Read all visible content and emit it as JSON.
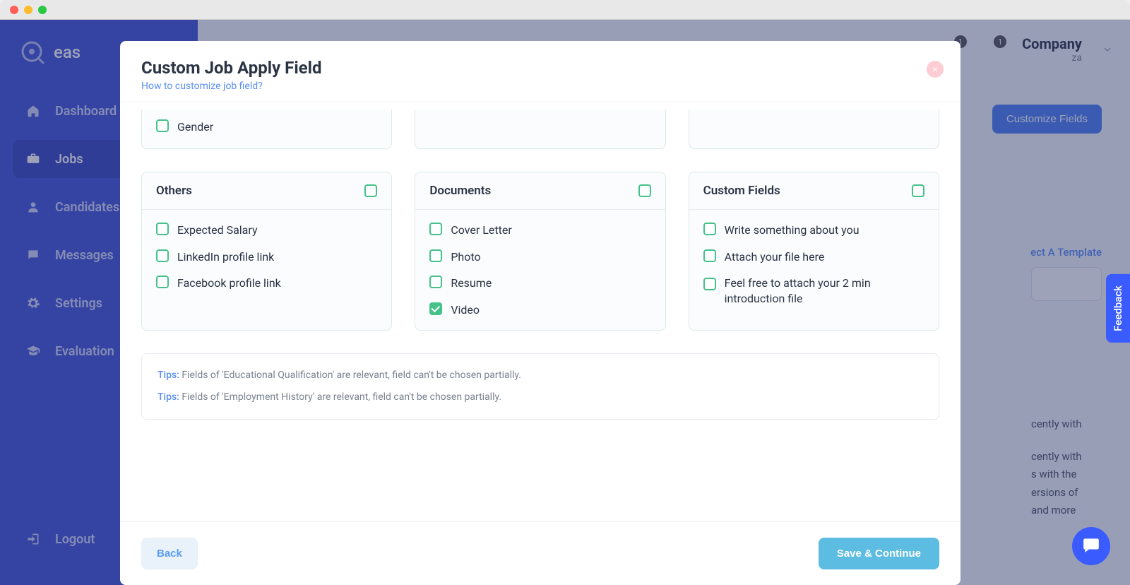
{
  "mac": {
    "title": ""
  },
  "brand": "eas",
  "nav": {
    "dashboard": "Dashboard",
    "jobs": "Jobs",
    "candidates": "Candidates",
    "messages": "Messages",
    "settings": "Settings",
    "evaluation": "Evaluation",
    "logout": "Logout"
  },
  "topbar": {
    "badge1": "1",
    "badge2": "1",
    "company_name": "Company",
    "company_sub": "za"
  },
  "bg": {
    "customize_btn": "Customize Fields",
    "template_link": "ect A Template",
    "lorem1": "cently with",
    "lorem2": "cently with",
    "lorem3": "s with the",
    "lorem4": "ersions of",
    "lorem5": "and more"
  },
  "modal": {
    "title": "Custom Job Apply Field",
    "sublink": "How to customize job field?",
    "close": "×",
    "top_partial": {
      "gender": "Gender"
    },
    "others": {
      "title": "Others",
      "items": [
        "Expected Salary",
        "LinkedIn profile link",
        "Facebook profile link"
      ]
    },
    "documents": {
      "title": "Documents",
      "items": [
        "Cover Letter",
        "Photo",
        "Resume",
        "Video"
      ],
      "checked_index": 3
    },
    "custom": {
      "title": "Custom Fields",
      "items": [
        "Write something about you",
        "Attach your file here",
        "Feel free to attach your 2 min introduction file"
      ]
    },
    "tips_label": "Tips:",
    "tip1": " Fields of 'Educational Qualification' are relevant, field can't be chosen partially.",
    "tip2": " Fields of 'Employment History' are relevant, field can't be chosen partially.",
    "back": "Back",
    "save": "Save & Continue"
  },
  "feedback": "Feedback"
}
